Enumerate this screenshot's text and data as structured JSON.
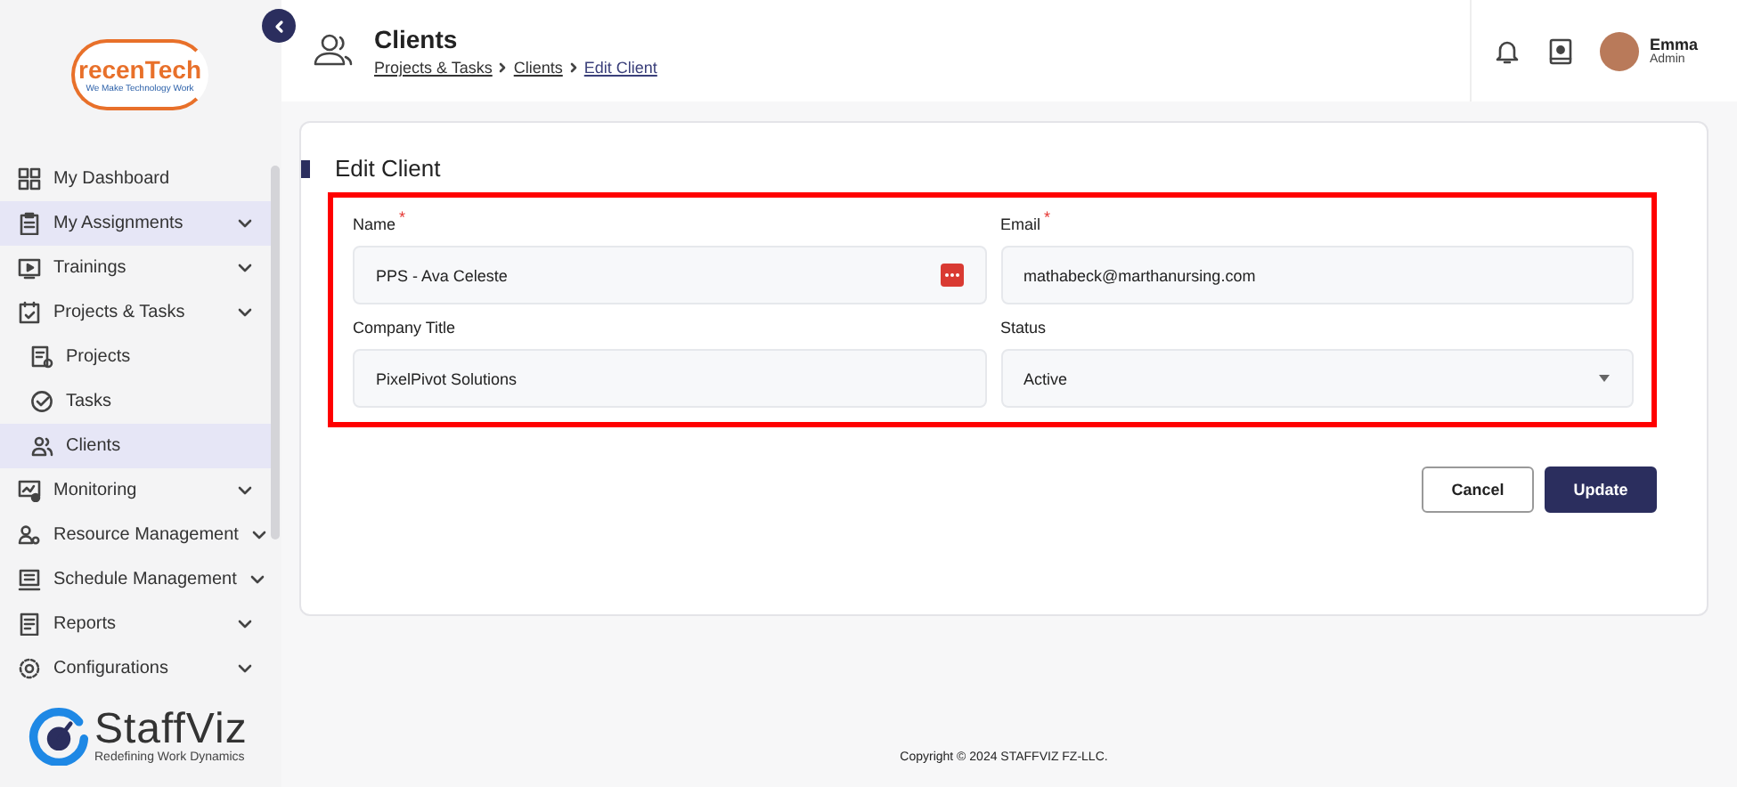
{
  "brand": {
    "name": "recenTech",
    "tagline": "We Make Technology Work"
  },
  "sidebar": {
    "items": [
      {
        "label": "My Dashboard",
        "expandable": false,
        "selected": false
      },
      {
        "label": "My Assignments",
        "expandable": true,
        "selected": true
      },
      {
        "label": "Trainings",
        "expandable": true,
        "selected": false
      },
      {
        "label": "Projects & Tasks",
        "expandable": true,
        "selected": false,
        "children": [
          {
            "label": "Projects",
            "selected": false
          },
          {
            "label": "Tasks",
            "selected": false
          },
          {
            "label": "Clients",
            "selected": true
          }
        ]
      },
      {
        "label": "Monitoring",
        "expandable": true,
        "selected": false
      },
      {
        "label": "Resource Management",
        "expandable": true,
        "selected": false
      },
      {
        "label": "Schedule Management",
        "expandable": true,
        "selected": false
      },
      {
        "label": "Reports",
        "expandable": true,
        "selected": false
      },
      {
        "label": "Configurations",
        "expandable": true,
        "selected": false
      }
    ]
  },
  "footer_brand": {
    "name": "StaffViz",
    "tagline": "Redefining Work Dynamics"
  },
  "header": {
    "title": "Clients",
    "breadcrumbs": [
      "Projects & Tasks",
      "Clients",
      "Edit Client"
    ],
    "user": {
      "name": "Emma",
      "role": "Admin"
    }
  },
  "form": {
    "title": "Edit Client",
    "fields": [
      {
        "kind": "text",
        "label": "Name",
        "required_mark": "*",
        "value": "PPS - Ava Celeste",
        "badge": true
      },
      {
        "kind": "text",
        "label": "Email",
        "required_mark": "*",
        "value": "mathabeck@marthanursing.com",
        "badge": false
      },
      {
        "kind": "text",
        "label": "Company Title",
        "value": "PixelPivot Solutions",
        "badge": false
      },
      {
        "kind": "select",
        "label": "Status",
        "value": "Active"
      }
    ],
    "buttons": [
      {
        "kind": "secondary",
        "label": "Cancel"
      },
      {
        "kind": "primary",
        "label": "Update"
      }
    ]
  },
  "copyright": "Copyright © 2024 STAFFVIZ FZ-LLC."
}
